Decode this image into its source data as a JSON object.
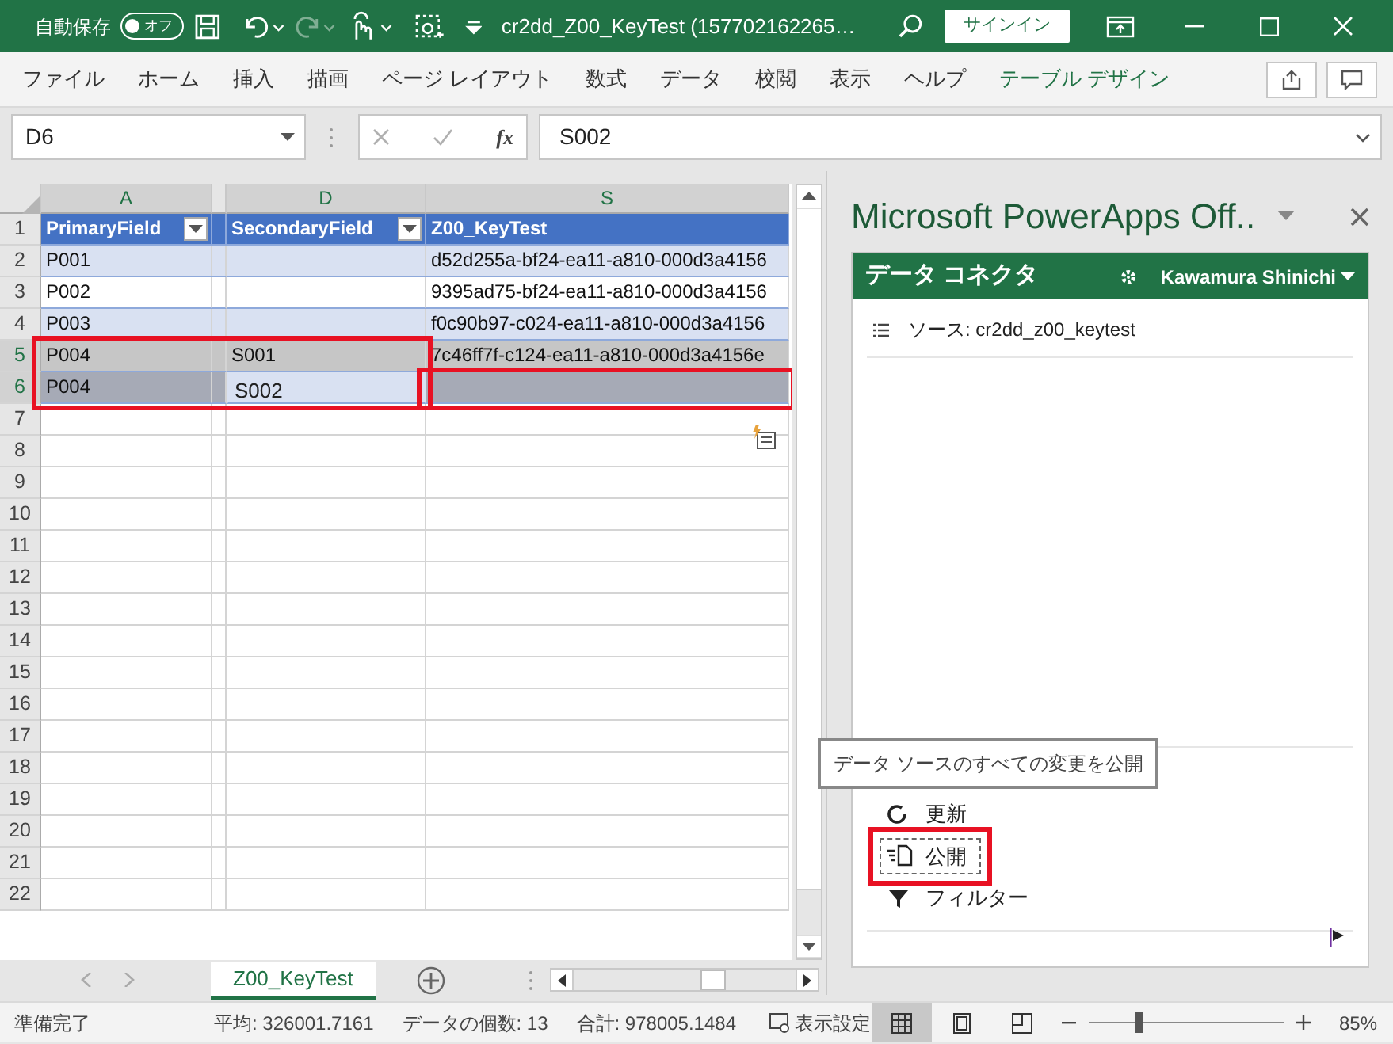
{
  "title_bar": {
    "autosave_label": "自動保存",
    "autosave": {
      "label": "オフ",
      "on": false
    },
    "redo_disabled": true,
    "title": "cr2dd_Z00_KeyTest (157702162265…",
    "sign_in": "サインイン"
  },
  "ribbon_tabs": [
    {
      "label": "ファイル",
      "kind": "normal"
    },
    {
      "label": "ホーム",
      "kind": "normal"
    },
    {
      "label": "挿入",
      "kind": "normal"
    },
    {
      "label": "描画",
      "kind": "normal"
    },
    {
      "label": "ページ レイアウト",
      "kind": "normal"
    },
    {
      "label": "数式",
      "kind": "normal"
    },
    {
      "label": "データ",
      "kind": "normal"
    },
    {
      "label": "校閲",
      "kind": "normal"
    },
    {
      "label": "表示",
      "kind": "normal"
    },
    {
      "label": "ヘルプ",
      "kind": "normal"
    },
    {
      "label": "テーブル デザイン",
      "kind": "contextual"
    }
  ],
  "formula_bar": {
    "name_box": "D6",
    "fx": "fx",
    "formula": "S002"
  },
  "sheet": {
    "columns": [
      {
        "label": "A",
        "kind": "wide",
        "selected": true
      },
      {
        "kind": "narrow",
        "selected": false
      },
      {
        "label": "D",
        "kind": "wide",
        "selected": true
      },
      {
        "label": "S",
        "kind": "wide",
        "selected": true
      }
    ],
    "rows": [
      {
        "number": "1",
        "kind": "header",
        "selected": false,
        "cells": [
          {
            "text": "PrimaryField",
            "filter": true
          },
          {},
          {
            "text": "SecondaryField",
            "filter": true
          },
          {
            "text": "Z00_KeyTest"
          }
        ]
      },
      {
        "number": "2",
        "kind": "data",
        "selected": false,
        "cells": [
          {
            "text": "P001"
          },
          {},
          {},
          {
            "text": "d52d255a-bf24-ea11-a810-000d3a4156"
          }
        ]
      },
      {
        "number": "3",
        "kind": "data",
        "selected": false,
        "cells": [
          {
            "text": "P002"
          },
          {},
          {},
          {
            "text": "9395ad75-bf24-ea11-a810-000d3a4156"
          }
        ]
      },
      {
        "number": "4",
        "kind": "data",
        "selected": false,
        "cells": [
          {
            "text": "P003"
          },
          {},
          {},
          {
            "text": "f0c90b97-c024-ea11-a810-000d3a4156"
          }
        ]
      },
      {
        "number": "5",
        "kind": "data",
        "selected": true,
        "cells": [
          {
            "text": "P004",
            "framed": true
          },
          {
            "framed": true
          },
          {
            "text": "S001",
            "framed": true
          },
          {
            "text": "7c46ff7f-c124-ea11-a810-000d3a4156e"
          }
        ]
      },
      {
        "number": "6",
        "kind": "data",
        "selected": true,
        "cells": [
          {
            "text": "P004",
            "framed": true
          },
          {
            "framed": true
          },
          {
            "text": "S002",
            "active": true,
            "framed": true
          },
          {
            "framed": true
          }
        ]
      },
      {
        "number": "7",
        "kind": "empty",
        "selected": false
      },
      {
        "number": "8",
        "kind": "empty",
        "selected": false
      },
      {
        "number": "9",
        "kind": "empty",
        "selected": false
      },
      {
        "number": "10",
        "kind": "empty",
        "selected": false
      },
      {
        "number": "11",
        "kind": "empty",
        "selected": false
      },
      {
        "number": "12",
        "kind": "empty",
        "selected": false
      },
      {
        "number": "13",
        "kind": "empty",
        "selected": false
      },
      {
        "number": "14",
        "kind": "empty",
        "selected": false
      },
      {
        "number": "15",
        "kind": "empty",
        "selected": false
      },
      {
        "number": "16",
        "kind": "empty",
        "selected": false
      },
      {
        "number": "17",
        "kind": "empty",
        "selected": false
      },
      {
        "number": "18",
        "kind": "empty",
        "selected": false
      },
      {
        "number": "19",
        "kind": "empty",
        "selected": false
      },
      {
        "number": "20",
        "kind": "empty",
        "selected": false
      },
      {
        "number": "21",
        "kind": "empty",
        "selected": false
      },
      {
        "number": "22",
        "kind": "empty",
        "selected": false
      }
    ]
  },
  "sheet_tabs": [
    {
      "label": "Z00_KeyTest",
      "selected": true
    }
  ],
  "task_pane": {
    "title": "Microsoft PowerApps Off..",
    "header": "データ コネクタ",
    "user": "Kawamura Shinichi",
    "source": "ソース: cr2dd_z00_keytest",
    "tooltip": "データ ソースのすべての変更を公開",
    "actions": [
      {
        "label": "更新",
        "kind": "refresh",
        "focused": false,
        "highlighted": false
      },
      {
        "label": "公開",
        "kind": "publish",
        "focused": true,
        "highlighted": true
      },
      {
        "label": "フィルター",
        "kind": "filter",
        "focused": false,
        "highlighted": false
      }
    ]
  },
  "status_bar": {
    "ready": "準備完了",
    "stats": [
      "平均: 326001.7161",
      "データの個数: 13",
      "合計: 978005.1484"
    ],
    "display_settings": "表示設定",
    "views": [
      {
        "kind": "normal",
        "selected": true
      },
      {
        "kind": "page-layout",
        "selected": false
      },
      {
        "kind": "page-break",
        "selected": false
      }
    ],
    "zoom": {
      "level": 0.25,
      "reading": "85%"
    }
  }
}
